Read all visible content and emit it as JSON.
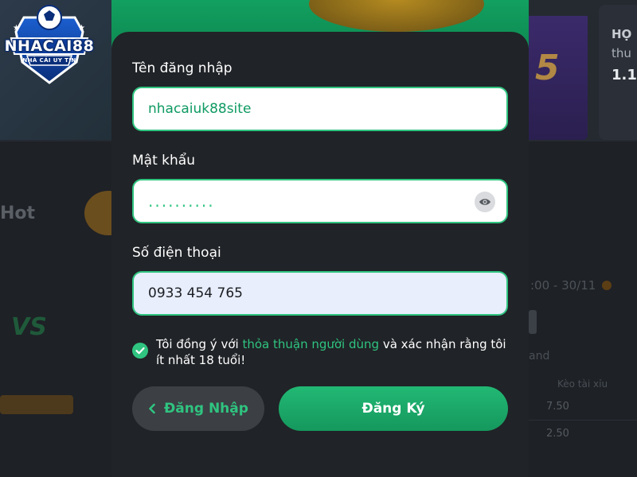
{
  "brand": {
    "logo_text": "NHACAI88",
    "tagline": "NHÀ CÁI UY TÍN"
  },
  "background": {
    "hot_label": "Hot",
    "vs_label": "VS",
    "right_card_line1": "HỌ",
    "right_card_line2": "thu",
    "right_card_line3": "1.1",
    "date_text": ":00 - 30/11",
    "and_text": "and",
    "keo_label": "Kèo tài xỉu",
    "value_1": "7.50",
    "value_2": "2.50"
  },
  "form": {
    "username": {
      "label": "Tên đăng nhập",
      "value": "nhacaiuk88site"
    },
    "password": {
      "label": "Mật khẩu",
      "value": ".........."
    },
    "phone": {
      "label": "Số điện thoại",
      "value": "0933 454 765"
    },
    "agreement": {
      "prefix": "Tôi đồng ý với ",
      "link": "thỏa thuận người dùng",
      "suffix": " và xác nhận rằng tôi ít nhất 18 tuổi!",
      "checked": true
    },
    "login_button": "Đăng Nhập",
    "register_button": "Đăng Ký"
  },
  "colors": {
    "accent": "#2fc480",
    "modal_bg": "#202327",
    "page_bg": "#1e2126"
  },
  "icons": {
    "eye": "eye-icon",
    "check": "check-icon",
    "chevron": "chevron-left-icon"
  }
}
